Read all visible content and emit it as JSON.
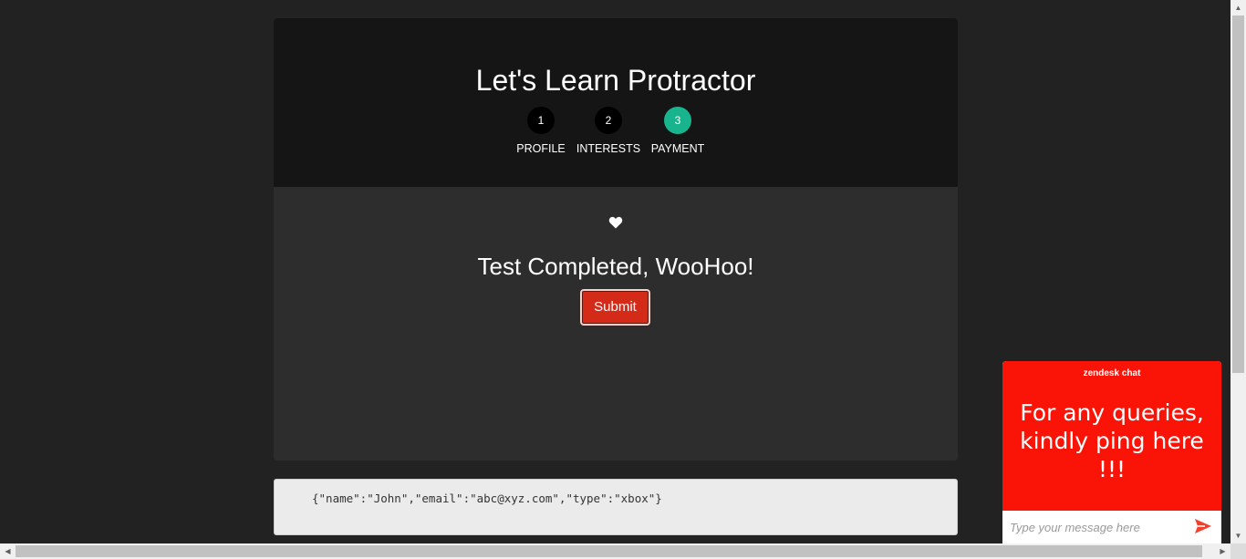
{
  "header": {
    "title": "Let's Learn Protractor",
    "steps": [
      {
        "number": "1",
        "label": "PROFILE",
        "active": false
      },
      {
        "number": "2",
        "label": "INTERESTS",
        "active": false
      },
      {
        "number": "3",
        "label": "PAYMENT",
        "active": true
      }
    ]
  },
  "main": {
    "icon": "heart-icon",
    "message": "Test Completed, WooHoo!",
    "submit_label": "Submit"
  },
  "json_output": "{\"name\":\"John\",\"email\":\"abc@xyz.com\",\"type\":\"xbox\"}",
  "chat": {
    "brand": "zendesk chat",
    "message": "For any queries, kindly ping here !!!",
    "input_placeholder": "Type your message here",
    "send_icon": "send-icon"
  },
  "colors": {
    "page_bg": "#222222",
    "header_bg": "#151515",
    "panel_bg": "#2d2d2d",
    "active_step": "#18b48e",
    "submit": "#d42a18",
    "chat_accent": "#fa1407"
  }
}
